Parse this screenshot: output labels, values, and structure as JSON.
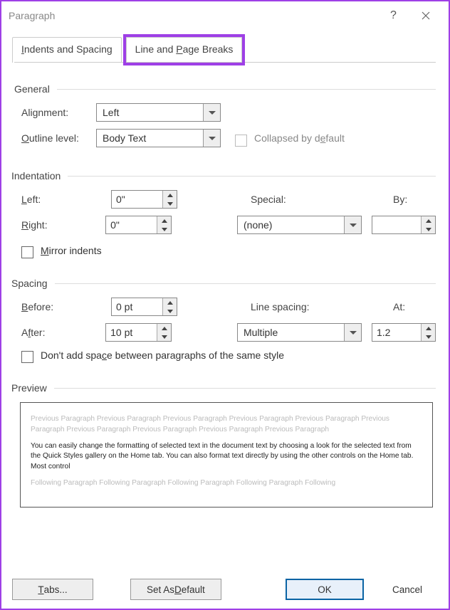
{
  "title": "Paragraph",
  "tabs": {
    "t1_pre": "I",
    "t1_rest": "ndents and Spacing",
    "t2_pre": "Line and ",
    "t2_u": "P",
    "t2_rest": "age Breaks"
  },
  "general": {
    "header": "General",
    "alignment_pre": "Ali",
    "alignment_u": "g",
    "alignment_rest": "nment:",
    "alignment_value": "Left",
    "outline_pre": "",
    "outline_u": "O",
    "outline_rest": "utline level:",
    "outline_value": "Body Text",
    "collapsed_pre": "Collapsed by d",
    "collapsed_u": "e",
    "collapsed_rest": "fault"
  },
  "indentation": {
    "header": "Indentation",
    "left_u": "L",
    "left_rest": "eft:",
    "left_value": "0\"",
    "right_u": "R",
    "right_rest": "ight:",
    "right_value": "0\"",
    "special_u": "S",
    "special_rest": "pecial:",
    "special_value": "(none)",
    "by_pre": "B",
    "by_u": "y",
    "by_rest": ":",
    "by_value": "",
    "mirror_u": "M",
    "mirror_rest": "irror indents"
  },
  "spacing": {
    "header": "Spacing",
    "before_u": "B",
    "before_rest": "efore:",
    "before_value": "0 pt",
    "after_pre": "A",
    "after_u": "f",
    "after_rest": "ter:",
    "after_value": "10 pt",
    "line_spacing_pre": "Li",
    "line_spacing_u": "n",
    "line_spacing_rest": "e spacing:",
    "line_spacing_value": "Multiple",
    "at_u": "A",
    "at_rest": "t:",
    "at_value": "1.2",
    "dont_add_pre": "Don't add spa",
    "dont_add_u": "c",
    "dont_add_rest": "e between paragraphs of the same style"
  },
  "preview": {
    "header": "Preview",
    "prev_text": "Previous Paragraph Previous Paragraph Previous Paragraph Previous Paragraph Previous Paragraph Previous Paragraph Previous Paragraph Previous Paragraph Previous Paragraph Previous Paragraph",
    "sample_text": "You can easily change the formatting of selected text in the document text by choosing a look for the selected text from the Quick Styles gallery on the Home tab. You can also format text directly by using the other controls on the Home tab. Most control",
    "after_text": "Following Paragraph Following Paragraph Following Paragraph Following Paragraph Following"
  },
  "buttons": {
    "tabs_u": "T",
    "tabs_rest": "abs...",
    "setdef_pre": "Set As ",
    "setdef_u": "D",
    "setdef_rest": "efault",
    "ok": "OK",
    "cancel": "Cancel"
  }
}
